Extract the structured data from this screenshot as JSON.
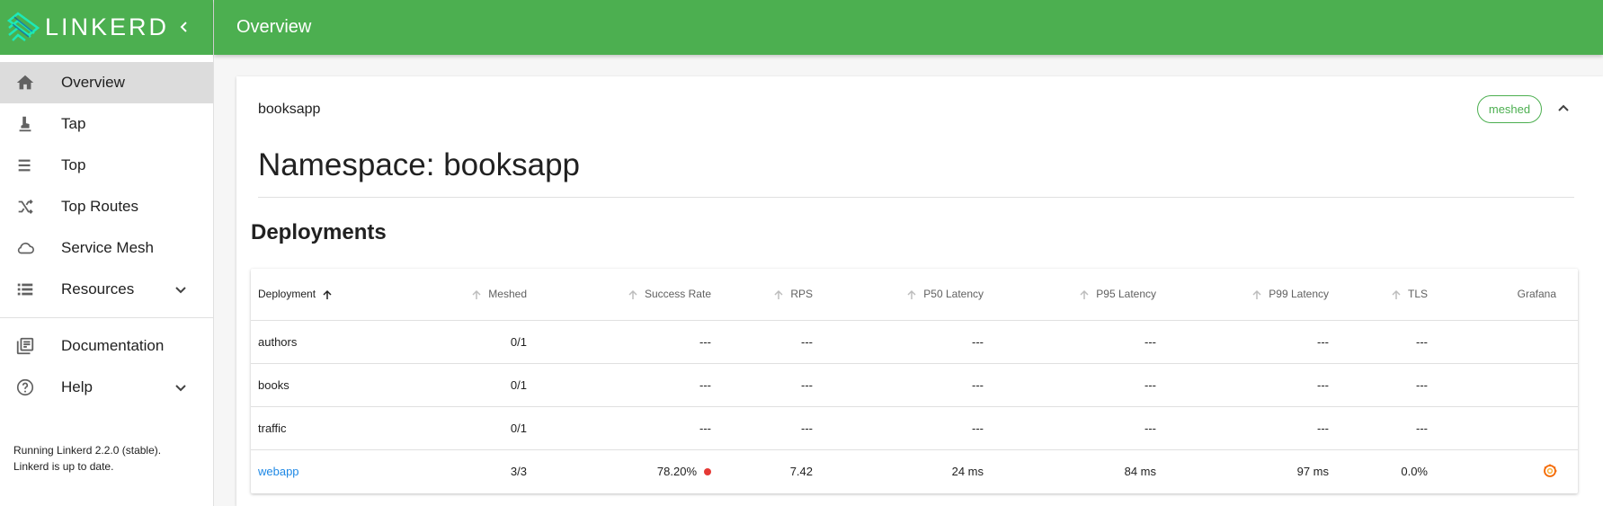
{
  "app": {
    "logo_text": "LINKERD",
    "accent_color": "#4caf50"
  },
  "topbar": {
    "title": "Overview"
  },
  "sidebar": {
    "items": [
      {
        "label": "Overview",
        "icon": "home-icon",
        "active": true
      },
      {
        "label": "Tap",
        "icon": "tap-icon"
      },
      {
        "label": "Top",
        "icon": "top-list-icon"
      },
      {
        "label": "Top Routes",
        "icon": "shuffle-icon"
      },
      {
        "label": "Service Mesh",
        "icon": "cloud-icon"
      },
      {
        "label": "Resources",
        "icon": "list-icon",
        "expandable": true
      }
    ],
    "secondary": [
      {
        "label": "Documentation",
        "icon": "library-books-icon"
      },
      {
        "label": "Help",
        "icon": "help-icon",
        "expandable": true
      }
    ],
    "footer": {
      "line1": "Running Linkerd 2.2.0 (stable).",
      "line2": "Linkerd is up to date."
    }
  },
  "card": {
    "header": "booksapp",
    "badge": "meshed",
    "namespace_title": "Namespace: booksapp",
    "section_title": "Deployments"
  },
  "table": {
    "headers": {
      "deployment": "Deployment",
      "meshed": "Meshed",
      "success_rate": "Success Rate",
      "rps": "RPS",
      "p50": "P50 Latency",
      "p95": "P95 Latency",
      "p99": "P99 Latency",
      "tls": "TLS",
      "grafana": "Grafana"
    },
    "rows": [
      {
        "deployment": "authors",
        "meshed": "0/1",
        "success_rate": "---",
        "rps": "---",
        "p50": "---",
        "p95": "---",
        "p99": "---",
        "tls": "---"
      },
      {
        "deployment": "books",
        "meshed": "0/1",
        "success_rate": "---",
        "rps": "---",
        "p50": "---",
        "p95": "---",
        "p99": "---",
        "tls": "---"
      },
      {
        "deployment": "traffic",
        "meshed": "0/1",
        "success_rate": "---",
        "rps": "---",
        "p50": "---",
        "p95": "---",
        "p99": "---",
        "tls": "---"
      },
      {
        "deployment": "webapp",
        "meshed": "3/3",
        "success_rate": "78.20%",
        "rps": "7.42",
        "p50": "24 ms",
        "p95": "84 ms",
        "p99": "97 ms",
        "tls": "0.0%",
        "status_color": "#e53935"
      }
    ]
  }
}
